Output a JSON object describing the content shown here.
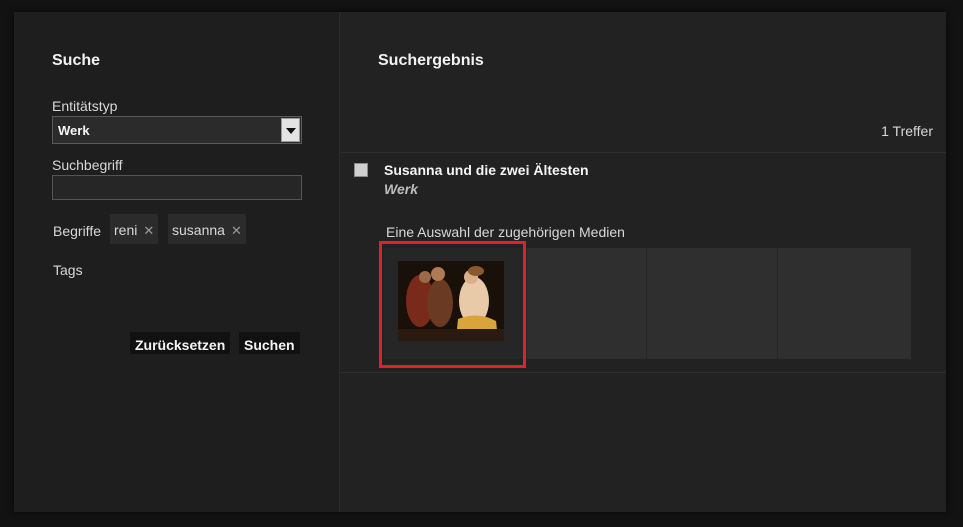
{
  "search": {
    "heading": "Suche",
    "entity_type_label": "Entitätstyp",
    "entity_type_value": "Werk",
    "term_label": "Suchbegriff",
    "term_value": "",
    "terms_label": "Begriffe",
    "terms": [
      "reni",
      "susanna"
    ],
    "tags_label": "Tags",
    "reset_label": "Zurücksetzen",
    "search_label": "Suchen"
  },
  "results": {
    "heading": "Suchergebnis",
    "count": "1 Treffer",
    "item": {
      "title": "Susanna und die zwei Ältesten",
      "type": "Werk",
      "media_caption": "Eine Auswahl der zugehörigen Medien"
    }
  },
  "colors": {
    "highlight": "#e0202a"
  }
}
